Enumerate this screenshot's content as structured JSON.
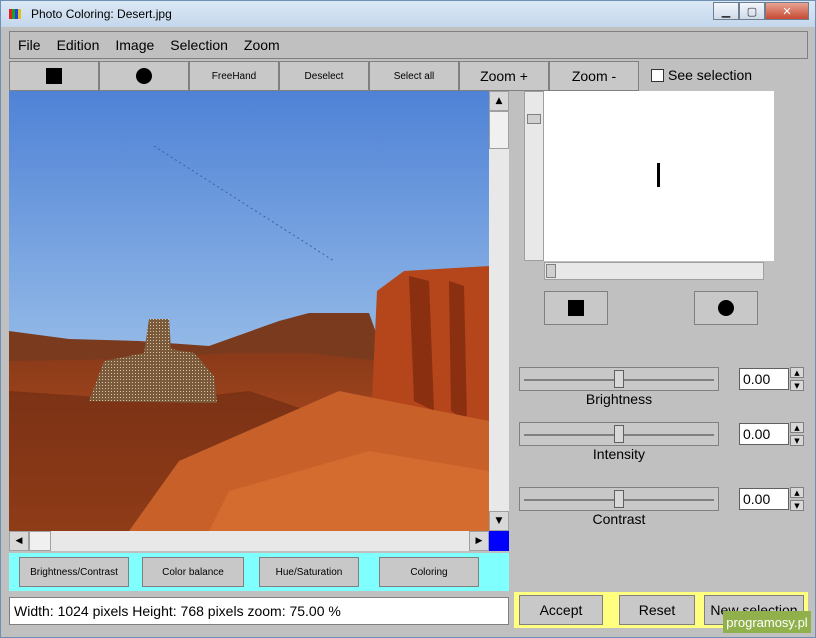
{
  "window": {
    "title": "Photo Coloring: Desert.jpg"
  },
  "menu": [
    "File",
    "Edition",
    "Image",
    "Selection",
    "Zoom"
  ],
  "toolbar": {
    "square_icon": "black-square-icon",
    "circle_icon": "black-circle-icon",
    "freehand": "FreeHand",
    "deselect": "Deselect",
    "select_all": "Select all",
    "zoom_in": "Zoom +",
    "zoom_out": "Zoom -",
    "see_selection": "See selection"
  },
  "adjustments": {
    "brightness_contrast": "Brightness/Contrast",
    "color_balance": "Color balance",
    "hue_saturation": "Hue/Saturation",
    "coloring": "Coloring"
  },
  "status": {
    "text": "Width: 1024 pixels Height: 768 pixels zoom: 75.00 %"
  },
  "sliders": [
    {
      "label": "Brightness",
      "value": "0.00",
      "level": 0.5
    },
    {
      "label": "Intensity",
      "value": "0.00",
      "level": 0.5
    },
    {
      "label": "Contrast",
      "value": "0.00",
      "level": 0.5
    }
  ],
  "actions": {
    "accept": "Accept",
    "reset": "Reset",
    "new_selection": "New selection"
  },
  "watermark": "programosy.pl",
  "colors": {
    "sky": "#6a9ee0",
    "rock": "#b5451b",
    "panel_cyan": "#80ffff",
    "panel_yellow": "#ffff80",
    "corner_blue": "#0000ff"
  }
}
